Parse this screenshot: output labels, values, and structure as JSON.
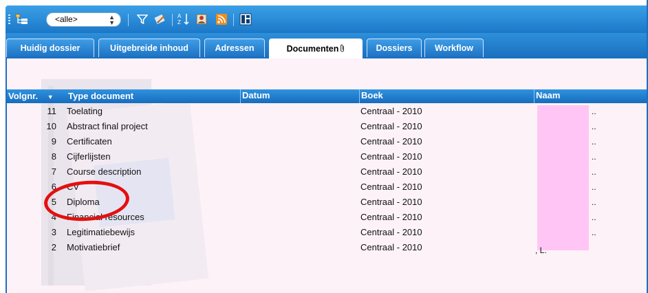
{
  "toolbar": {
    "filter_select_value": "<alle>",
    "icons": [
      "tree-view-icon",
      "filter-icon",
      "edit-icon",
      "sort-az-icon",
      "contact-card-icon",
      "rss-feed-icon",
      "layout-icon"
    ]
  },
  "tabs": [
    {
      "label": "Huidig dossier"
    },
    {
      "label": "Uitgebreide inhoud"
    },
    {
      "label": "Adressen"
    },
    {
      "label": "Documenten",
      "active": true
    },
    {
      "label": "Dossiers"
    },
    {
      "label": "Workflow"
    }
  ],
  "table": {
    "columns": [
      "Volgnr.",
      "Type document",
      "Datum",
      "Boek",
      "Naam"
    ],
    "rows": [
      {
        "num": "11",
        "type": "Toelating",
        "book": "Centraal - 2010"
      },
      {
        "num": "10",
        "type": "Abstract final project",
        "book": "Centraal - 2010"
      },
      {
        "num": "9",
        "type": "Certificaten",
        "book": "Centraal - 2010"
      },
      {
        "num": "8",
        "type": "Cijferlijsten",
        "book": "Centraal - 2010"
      },
      {
        "num": "7",
        "type": "Course description",
        "book": "Centraal - 2010"
      },
      {
        "num": "6",
        "type": "CV",
        "book": "Centraal - 2010"
      },
      {
        "num": "5",
        "type": "Diploma",
        "book": "Centraal - 2010"
      },
      {
        "num": "4",
        "type": "Financial resources",
        "book": "Centraal - 2010"
      },
      {
        "num": "3",
        "type": "Legitimatiebewijs",
        "book": "Centraal - 2010"
      },
      {
        "num": "2",
        "type": "Motivatiebrief",
        "book": "Centraal - 2010"
      }
    ],
    "name_tail": ", L."
  },
  "colors": {
    "accent_blue": "#1b78c8",
    "row_background": "#fdf2f8",
    "redaction": "#ffc6f5",
    "annotation_circle": "#e3100f"
  }
}
